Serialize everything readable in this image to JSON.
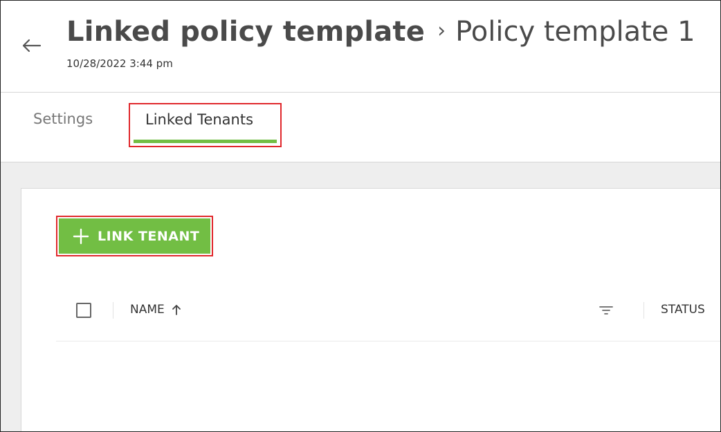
{
  "header": {
    "title": "Linked policy template",
    "breadcrumb_separator": "›",
    "subtitle": "Policy template 1",
    "timestamp": "10/28/2022 3:44 pm"
  },
  "tabs": [
    {
      "label": "Settings",
      "active": false
    },
    {
      "label": "Linked Tenants",
      "active": true
    }
  ],
  "actions": {
    "link_tenant_label": "LINK TENANT"
  },
  "table": {
    "columns": [
      {
        "label": "NAME",
        "sort": "ascending"
      },
      {
        "label": "STATUS"
      }
    ],
    "rows": []
  },
  "colors": {
    "accent_green": "#72be44",
    "highlight_red": "#e0272b",
    "page_background": "#eeeeee",
    "text": "#4a4a4a"
  },
  "icons": {
    "back": "arrow-left-icon",
    "add": "plus-icon",
    "sort": "arrow-up-icon",
    "filter": "filter-icon"
  }
}
